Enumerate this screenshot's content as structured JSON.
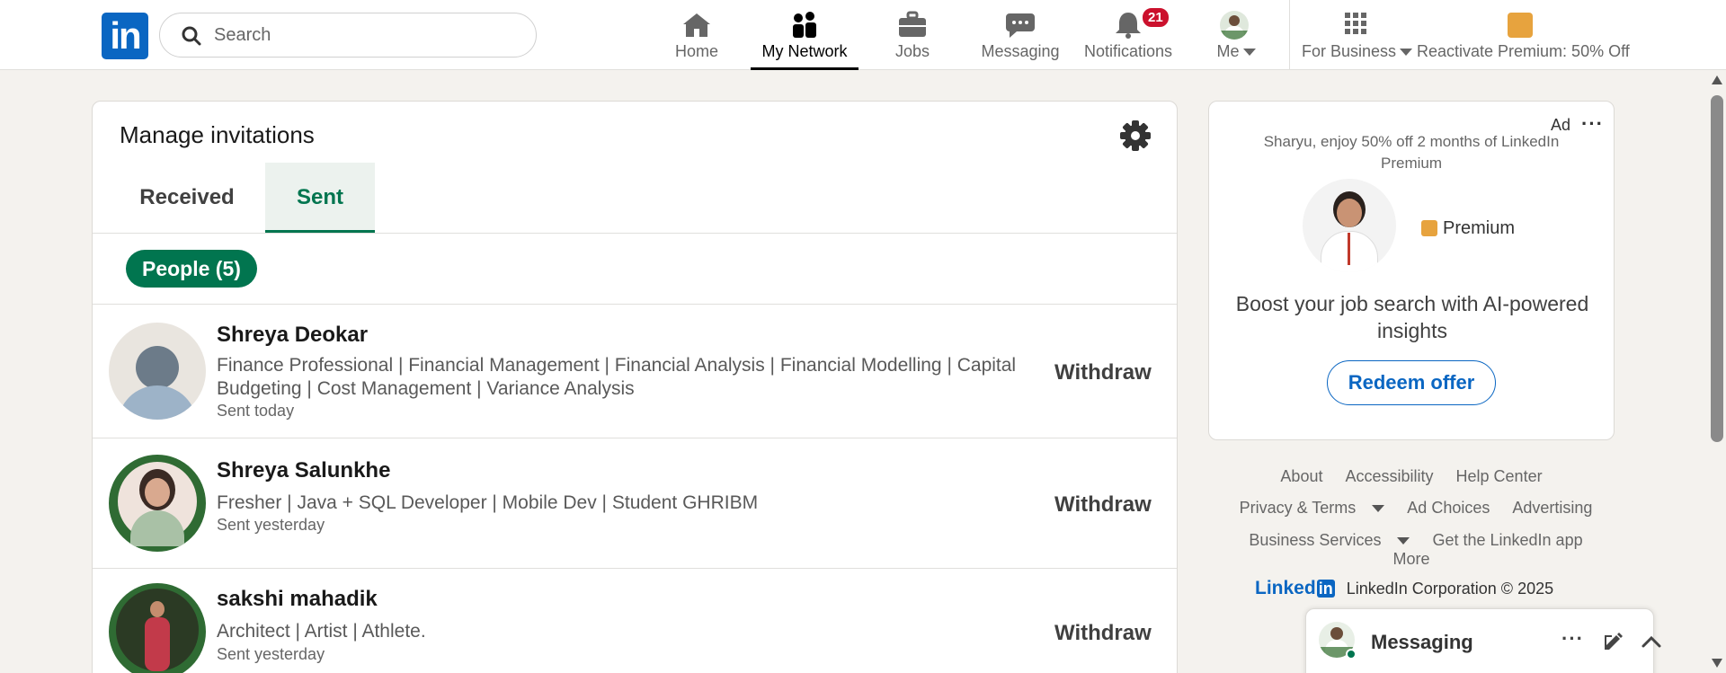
{
  "nav": {
    "logo": "in",
    "search_placeholder": "Search",
    "home": "Home",
    "network": "My Network",
    "jobs": "Jobs",
    "messaging": "Messaging",
    "notifications": "Notifications",
    "notifications_count": "21",
    "me": "Me",
    "for_business": "For Business",
    "premium": "Reactivate Premium: 50% Off"
  },
  "invitations": {
    "title": "Manage invitations",
    "tabs": [
      {
        "label": "Received"
      },
      {
        "label": "Sent"
      }
    ],
    "filter": "People (5)",
    "people": [
      {
        "name": "Shreya Deokar",
        "headline": "Finance Professional | Financial Management | Financial Analysis | Financial Modelling | Capital Budgeting | Cost Management | Variance Analysis",
        "sent": "Sent today",
        "action": "Withdraw"
      },
      {
        "name": "Shreya Salunkhe",
        "headline": "Fresher | Java + SQL Developer |  Mobile Dev | Student GHRIBM",
        "sent": "Sent yesterday",
        "action": "Withdraw"
      },
      {
        "name": "sakshi mahadik",
        "headline": "Architect | Artist | Athlete.",
        "sent": "Sent yesterday",
        "action": "Withdraw"
      }
    ]
  },
  "ad": {
    "label": "Ad",
    "more": "···",
    "line": "Sharyu, enjoy 50% off 2 months of LinkedIn Premium",
    "premium": "Premium",
    "boost": "Boost your job search with AI-powered insights",
    "button": "Redeem offer"
  },
  "footer": {
    "about": "About",
    "accessibility": "Accessibility",
    "help": "Help Center",
    "privacy": "Privacy & Terms",
    "adchoices": "Ad Choices",
    "advertising": "Advertising",
    "business": "Business Services",
    "app": "Get the LinkedIn app",
    "more": "More",
    "brand_word": "Linked",
    "brand_in": "in",
    "copyright": "LinkedIn Corporation © 2025"
  },
  "messaging": {
    "title": "Messaging"
  },
  "colors": {
    "linkedin_blue": "#0a66c2",
    "green": "#01754f",
    "badge_red": "#cb112d"
  }
}
